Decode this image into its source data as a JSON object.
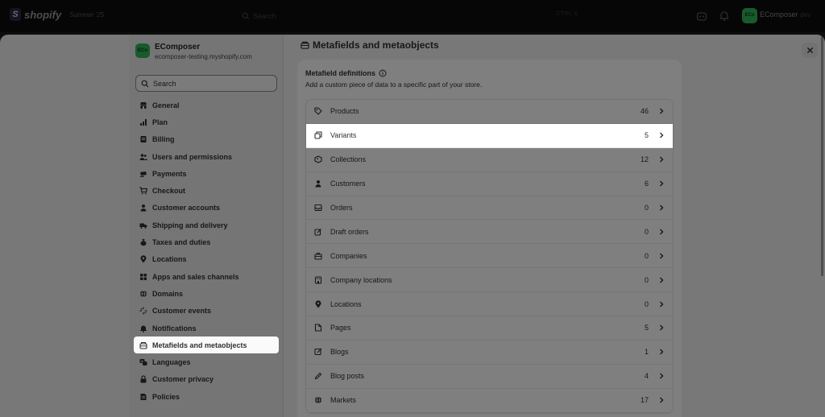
{
  "topbar": {
    "logo_mark": "S",
    "brand": "shopify",
    "edition": "Summer '25",
    "search_placeholder": "Search",
    "search_shortcut": "CTRL K",
    "store_initials": "ECo",
    "store_name": "EComposer",
    "store_env": "dev"
  },
  "sidebar": {
    "store_initials": "ECo",
    "store_name": "EComposer",
    "store_domain": "ecomposer-testing.myshopify.com",
    "search_placeholder": "Search",
    "items": [
      {
        "label": "General",
        "icon": "store-icon"
      },
      {
        "label": "Plan",
        "icon": "plan-icon"
      },
      {
        "label": "Billing",
        "icon": "billing-icon"
      },
      {
        "label": "Users and permissions",
        "icon": "users-icon"
      },
      {
        "label": "Payments",
        "icon": "payments-icon"
      },
      {
        "label": "Checkout",
        "icon": "cart-icon"
      },
      {
        "label": "Customer accounts",
        "icon": "person-icon"
      },
      {
        "label": "Shipping and delivery",
        "icon": "truck-icon"
      },
      {
        "label": "Taxes and duties",
        "icon": "tax-icon"
      },
      {
        "label": "Locations",
        "icon": "location-icon"
      },
      {
        "label": "Apps and sales channels",
        "icon": "apps-icon"
      },
      {
        "label": "Domains",
        "icon": "globe-icon"
      },
      {
        "label": "Customer events",
        "icon": "events-icon"
      },
      {
        "label": "Notifications",
        "icon": "bell-icon"
      },
      {
        "label": "Metafields and metaobjects",
        "icon": "metafields-icon",
        "active": true
      },
      {
        "label": "Languages",
        "icon": "language-icon"
      },
      {
        "label": "Customer privacy",
        "icon": "lock-icon"
      },
      {
        "label": "Policies",
        "icon": "policies-icon"
      }
    ]
  },
  "main": {
    "title": "Metafields and metaobjects",
    "section_title": "Metafield definitions",
    "section_desc": "Add a custom piece of data to a specific part of your store.",
    "rows": [
      {
        "label": "Products",
        "count": "46",
        "icon": "tag-icon"
      },
      {
        "label": "Variants",
        "count": "5",
        "icon": "variants-icon",
        "highlight": true
      },
      {
        "label": "Collections",
        "count": "12",
        "icon": "collections-icon"
      },
      {
        "label": "Customers",
        "count": "6",
        "icon": "person-icon"
      },
      {
        "label": "Orders",
        "count": "0",
        "icon": "inbox-icon"
      },
      {
        "label": "Draft orders",
        "count": "0",
        "icon": "draft-icon"
      },
      {
        "label": "Companies",
        "count": "0",
        "icon": "company-icon"
      },
      {
        "label": "Company locations",
        "count": "0",
        "icon": "company-location-icon"
      },
      {
        "label": "Locations",
        "count": "0",
        "icon": "location-icon"
      },
      {
        "label": "Pages",
        "count": "5",
        "icon": "page-icon"
      },
      {
        "label": "Blogs",
        "count": "1",
        "icon": "blog-icon"
      },
      {
        "label": "Blog posts",
        "count": "4",
        "icon": "pencil-icon"
      },
      {
        "label": "Markets",
        "count": "17",
        "icon": "globe-icon"
      }
    ]
  },
  "colors": {
    "topbar_bg": "#0c0c0c",
    "brand_green": "#30b45b",
    "panel_bg": "#f0f0f0",
    "card_bg": "#ffffff"
  }
}
